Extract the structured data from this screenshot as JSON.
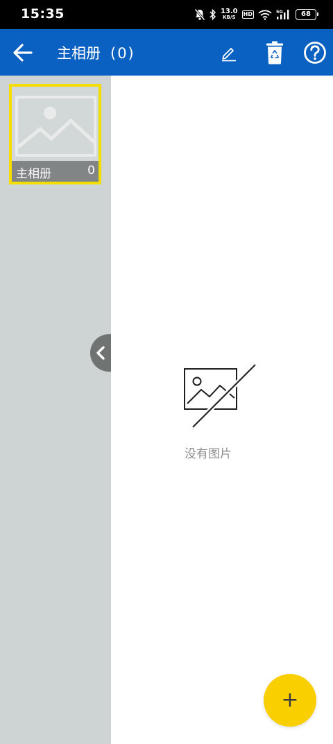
{
  "status_bar": {
    "time": "15:35",
    "net_speed_value": "13.0",
    "net_speed_unit": "KB/S",
    "hd_badge": "HD",
    "signal_badge": "5G",
    "battery": "68",
    "icons": [
      "bell-off-icon",
      "bluetooth-icon",
      "wifi-icon",
      "signal-icon",
      "battery-icon"
    ]
  },
  "toolbar": {
    "title": "主相册",
    "count": "(0)",
    "icons": [
      "back-arrow-icon",
      "edit-pencil-icon",
      "recycle-bin-icon",
      "help-icon"
    ],
    "background_color": "#0a61c1"
  },
  "albums": [
    {
      "name": "主相册",
      "count": "0",
      "selected": true
    }
  ],
  "empty_state": {
    "message": "没有图片",
    "icon": "no-image-icon"
  },
  "fab": {
    "label": "+",
    "color": "#f9cf00"
  },
  "colors": {
    "side_panel": "#cdd4d3",
    "selection_border": "#f5dd00"
  }
}
